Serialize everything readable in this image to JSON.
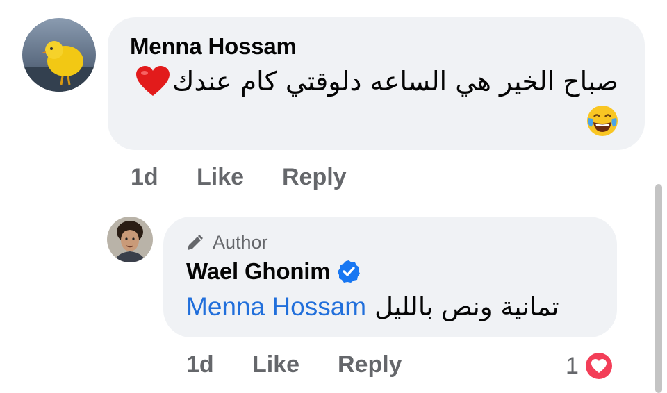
{
  "comment": {
    "author": "Menna Hossam",
    "text": "صباح الخير هي الساعه دلوقتي كام عندك",
    "avatar_icon": "chick-photo-avatar",
    "emojis": [
      "red-heart-emoji",
      "tears-of-joy-emoji"
    ],
    "time": "1d",
    "like_label": "Like",
    "reply_label": "Reply"
  },
  "reply": {
    "badge_label": "Author",
    "badge_icon": "pencil-icon",
    "author": "Wael Ghonim",
    "verified_icon": "verified-badge-icon",
    "mention": "Menna Hossam",
    "text": "تمانية ونص بالليل",
    "avatar_icon": "man-photo-avatar",
    "time": "1d",
    "like_label": "Like",
    "reply_label": "Reply",
    "reaction_count": "1",
    "reaction_icon": "love-reaction-icon"
  },
  "colors": {
    "bubble_bg": "#f0f2f5",
    "secondary_text": "#65676b",
    "mention_blue": "#216fdb",
    "verified_blue": "#1877f2",
    "love_red": "#f33e58"
  }
}
